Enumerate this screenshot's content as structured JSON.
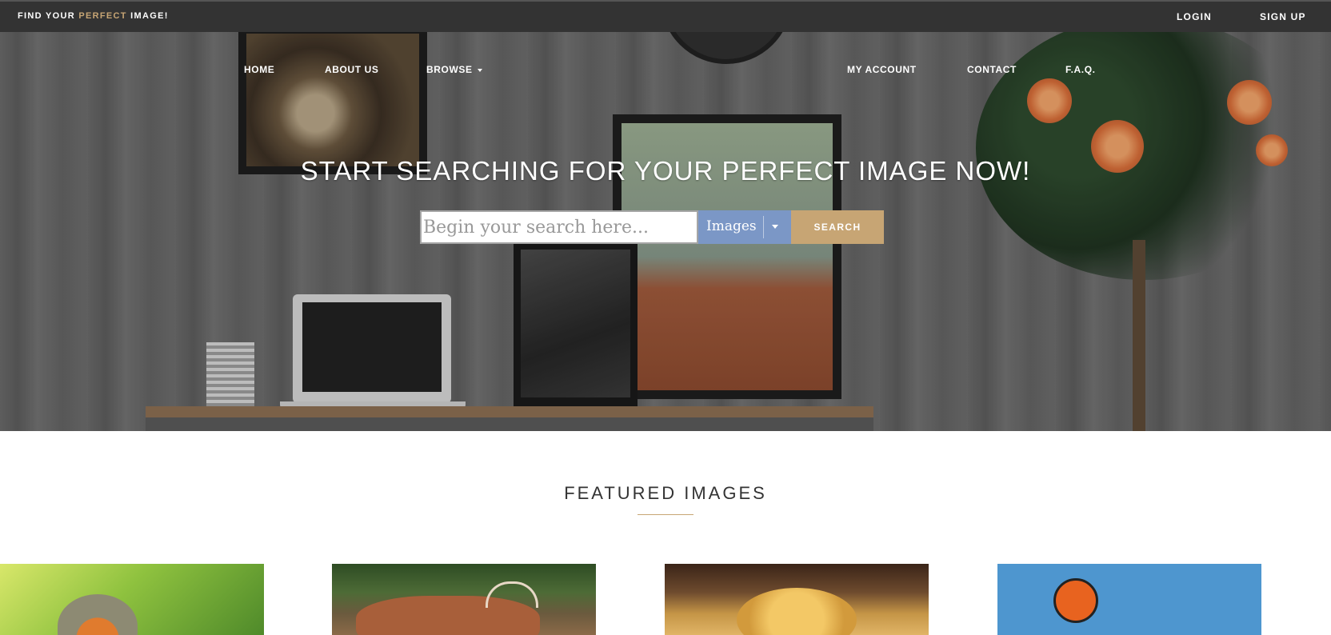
{
  "topbar": {
    "brand_prefix": "FIND YOUR ",
    "brand_accent": "PERFECT",
    "brand_suffix": " IMAGE!",
    "login": "LOGIN",
    "signup": "SIGN UP"
  },
  "nav": {
    "home": "HOME",
    "about": "ABOUT US",
    "browse": "BROWSE",
    "account": "MY ACCOUNT",
    "contact": "CONTACT",
    "faq": "F.A.Q."
  },
  "hero": {
    "title": "START SEARCHING FOR YOUR PERFECT IMAGE NOW!"
  },
  "search": {
    "placeholder": "Begin your search here...",
    "type_selected": "Images",
    "button": "SEARCH"
  },
  "featured": {
    "title": "FEATURED IMAGES",
    "items": [
      {
        "subject": "robin"
      },
      {
        "subject": "deer"
      },
      {
        "subject": "pancakes"
      },
      {
        "subject": "illustration"
      }
    ]
  },
  "colors": {
    "topbar": "#333333",
    "accent": "#c7a574",
    "select": "#7b97c6"
  }
}
